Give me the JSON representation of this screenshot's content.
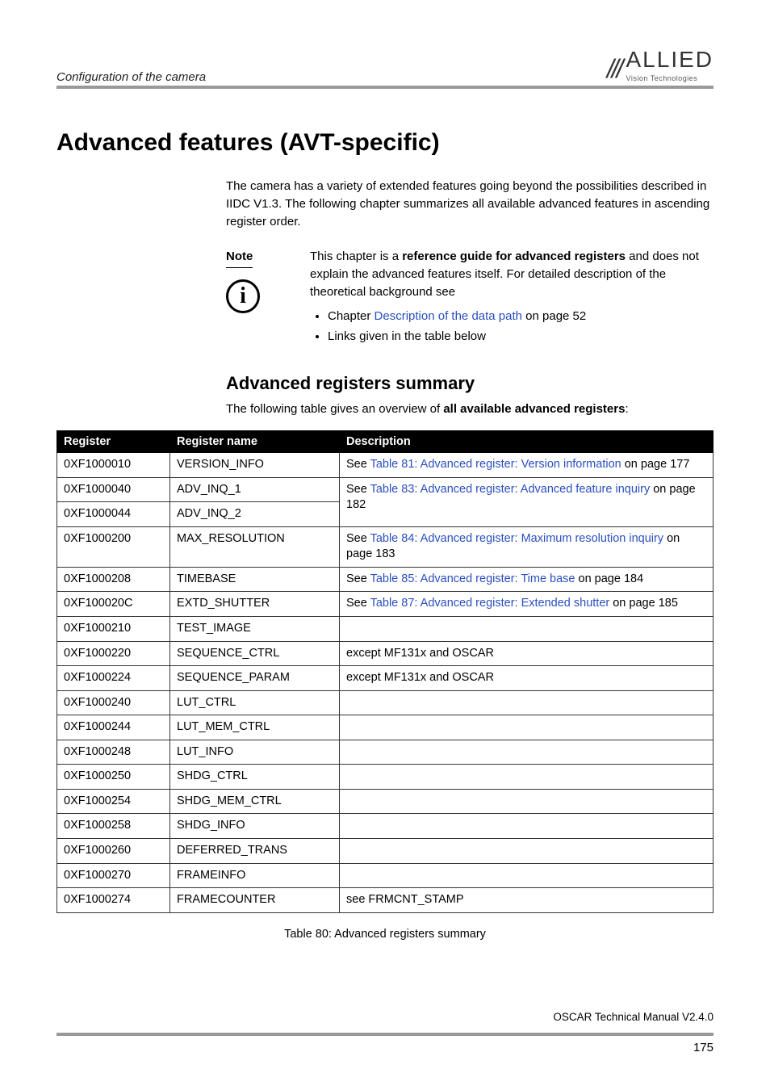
{
  "header": {
    "section": "Configuration of the camera",
    "logo_main": "ALLIED",
    "logo_sub": "Vision Technologies"
  },
  "title": "Advanced features (AVT-specific)",
  "intro": "The camera has a variety of extended features going beyond the possibilities described in IIDC V1.3. The following chapter summarizes all available advanced features in ascending register order.",
  "note": {
    "label": "Note",
    "text_prefix": "This chapter is a ",
    "text_bold": "reference guide for advanced registers",
    "text_suffix": " and does not explain the advanced features itself. For detailed description of the theoretical background see",
    "bullet1_pre": "Chapter ",
    "bullet1_link": "Description of the data path",
    "bullet1_post": " on page 52",
    "bullet2": "Links given in the table below"
  },
  "subheading": "Advanced registers summary",
  "sub_intro_pre": "The following table gives an overview of ",
  "sub_intro_bold": "all available advanced registers",
  "sub_intro_post": ":",
  "table": {
    "headers": {
      "c1": "Register",
      "c2": "Register name",
      "c3": "Description"
    },
    "rows": [
      {
        "reg": "0XF1000010",
        "name": "VERSION_INFO",
        "desc_pre": "See ",
        "desc_link": "Table 81: Advanced register: Version information",
        "desc_post": " on page 177"
      },
      {
        "reg": "0XF1000040",
        "name": "ADV_INQ_1"
      },
      {
        "reg": "0XF1000044",
        "name": "ADV_INQ_2"
      },
      {
        "reg": "0XF1000200",
        "name": "MAX_RESOLUTION",
        "desc_pre": "See ",
        "desc_link": "Table 84: Advanced register: Maximum resolution inquiry",
        "desc_post": " on page 183"
      },
      {
        "reg": "0XF1000208",
        "name": "TIMEBASE",
        "desc_pre": "See ",
        "desc_link": "Table 85: Advanced register: Time base",
        "desc_post": " on page 184"
      },
      {
        "reg": "0XF100020C",
        "name": "EXTD_SHUTTER",
        "desc_pre": "See ",
        "desc_link": "Table 87: Advanced register: Extended shutter",
        "desc_post": " on page 185"
      },
      {
        "reg": "0XF1000210",
        "name": "TEST_IMAGE",
        "desc_plain": ""
      },
      {
        "reg": "0XF1000220",
        "name": "SEQUENCE_CTRL",
        "desc_plain": "except MF131x and OSCAR"
      },
      {
        "reg": "0XF1000224",
        "name": "SEQUENCE_PARAM",
        "desc_plain": "except MF131x and OSCAR"
      },
      {
        "reg": "0XF1000240",
        "name": "LUT_CTRL",
        "desc_plain": ""
      },
      {
        "reg": "0XF1000244",
        "name": "LUT_MEM_CTRL",
        "desc_plain": ""
      },
      {
        "reg": "0XF1000248",
        "name": "LUT_INFO",
        "desc_plain": ""
      },
      {
        "reg": "0XF1000250",
        "name": "SHDG_CTRL",
        "desc_plain": ""
      },
      {
        "reg": "0XF1000254",
        "name": "SHDG_MEM_CTRL",
        "desc_plain": ""
      },
      {
        "reg": "0XF1000258",
        "name": "SHDG_INFO",
        "desc_plain": ""
      },
      {
        "reg": "0XF1000260",
        "name": "DEFERRED_TRANS",
        "desc_plain": ""
      },
      {
        "reg": "0XF1000270",
        "name": "FRAMEINFO",
        "desc_plain": ""
      },
      {
        "reg": "0XF1000274",
        "name": "FRAMECOUNTER",
        "desc_plain": "see FRMCNT_STAMP"
      }
    ],
    "merged_desc_pre": "See ",
    "merged_desc_link": "Table 83: Advanced register: Advanced feature inquiry",
    "merged_desc_post": " on page 182"
  },
  "table_caption": "Table 80: Advanced registers summary",
  "footer": {
    "doc": "OSCAR Technical Manual V2.4.0",
    "page": "175"
  }
}
